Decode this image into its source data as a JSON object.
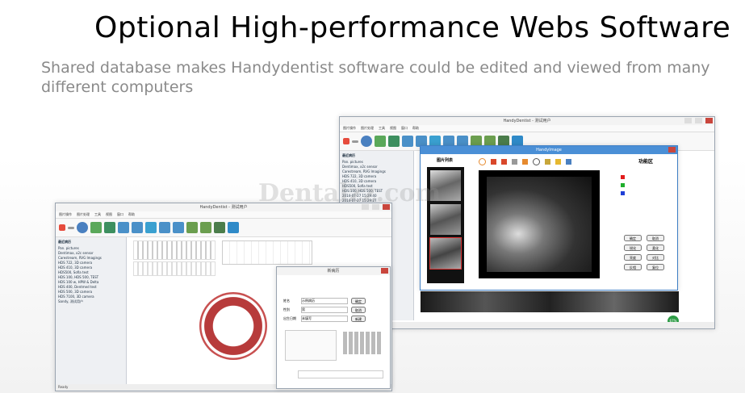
{
  "headline": "Optional High-performance Webs Software",
  "subline": "Shared database makes Handydentist software could be edited and viewed from many different computers",
  "watermark": "Dentalzz.com",
  "back_window": {
    "title": "HandyDentist - 测试用户",
    "menu": [
      "图片操作",
      "图片处理",
      "工具",
      "视图",
      "窗口",
      "帮助"
    ],
    "sidebar_head": "最近病历",
    "sidebar_items": [
      "Pan. pictures",
      "Dentimax, x2c sensor",
      "Carestream, RVG Imagings",
      "HDS 722, 3D camera",
      "HDS 410, 3D camera",
      "HDS500, Sofia test",
      "HDS 100, HDS 500, TEST",
      "2014-07-27 15:29:40",
      "2014-07-27 15:29:27",
      "2014-07-27 15:29:35"
    ],
    "status": "Ready",
    "badge": "67%"
  },
  "image_dialog": {
    "title": "HandyImage",
    "list_label": "图片列表",
    "function_label": "功能区",
    "buttons": [
      "确定",
      "取消",
      "锐化",
      "柔化",
      "亮度",
      "对比",
      "反相",
      "复位"
    ]
  },
  "front_window": {
    "title": "HandyDentist - 测试用户",
    "menu": [
      "图片操作",
      "图片处理",
      "工具",
      "视图",
      "窗口",
      "帮助"
    ],
    "sidebar_head": "最近病历",
    "sidebar_items": [
      "Pan. pictures",
      "Dentimax, x2c sensor",
      "Carestream, RVG Imagings",
      "HDS 722, 3D camera",
      "HDS 410, 3D camera",
      "HDS500, Sofia test",
      "HDS 100, HDS 500, TEST",
      "HDS 100 w, HPW & Delta",
      "HDS 400, Dentmed test",
      "HDS 500, 3D camera",
      "HDS 7100, 3D camera",
      "Sandy, 测试用户"
    ],
    "status": "Ready",
    "badge": "67%"
  },
  "record_dialog": {
    "title": "新病历",
    "fields": [
      "姓名",
      "性别",
      "出生日期"
    ],
    "values": [
      "示例病历",
      "男",
      "未填写"
    ],
    "buttons": [
      "确定",
      "取消",
      "新建"
    ]
  }
}
